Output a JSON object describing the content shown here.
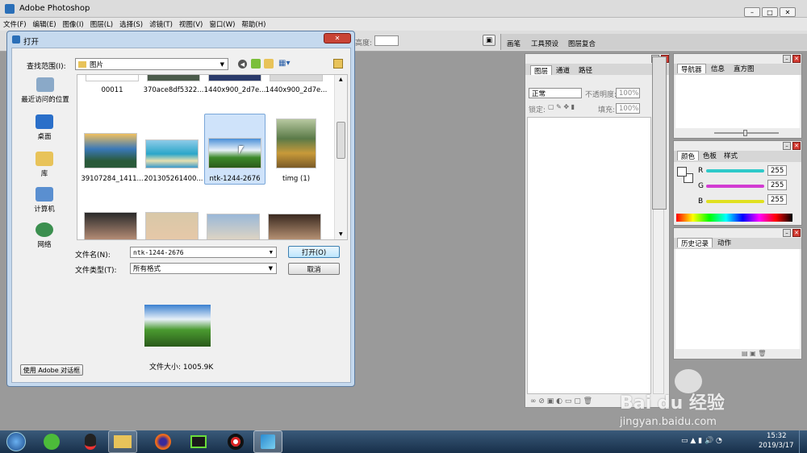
{
  "app": {
    "title": "Adobe Photoshop"
  },
  "menu": [
    "文件(F)",
    "编辑(E)",
    "图像(I)",
    "图层(L)",
    "选择(S)",
    "滤镜(T)",
    "视图(V)",
    "窗口(W)",
    "帮助(H)"
  ],
  "options": {
    "height_label": "高度:"
  },
  "palette_tabs": [
    "画笔",
    "工具预设",
    "图层复合"
  ],
  "dialog": {
    "title": "打开",
    "lookin_label": "查找范围(I):",
    "lookin_value": "图片",
    "places": [
      "最近访问的位置",
      "桌面",
      "库",
      "计算机",
      "网络"
    ],
    "files_row0": [
      "00011",
      "370ace8df5322...",
      "1440x900_2d7e...",
      "1440x900_2d7e..."
    ],
    "files_row1": [
      "39107284_1411...",
      "201305261400...",
      "ntk-1244-2676",
      "timg (1)"
    ],
    "filename_label": "文件名(N):",
    "filename_value": "ntk-1244-2676",
    "filetype_label": "文件类型(T):",
    "filetype_value": "所有格式",
    "open_button": "打开(O)",
    "cancel_button": "取消",
    "filesize": "文件大小: 1005.9K",
    "adobe_dialog_button": "使用 Adobe 对话框"
  },
  "layers": {
    "tabs": [
      "图层",
      "通道",
      "路径"
    ],
    "blend": "正常",
    "opacity_label": "不透明度:",
    "opacity": "100%",
    "lock_label": "锁定:",
    "fill_label": "填充:",
    "fill": "100%"
  },
  "navigator": {
    "tabs": [
      "导航器",
      "信息",
      "直方图"
    ]
  },
  "color": {
    "tabs": [
      "颜色",
      "色板",
      "样式"
    ],
    "channels": [
      {
        "label": "R",
        "value": "255",
        "color": "#2ec9c9"
      },
      {
        "label": "G",
        "value": "255",
        "color": "#d23cd2"
      },
      {
        "label": "B",
        "value": "255",
        "color": "#e0e020"
      }
    ]
  },
  "history": {
    "tabs": [
      "历史记录",
      "动作"
    ]
  },
  "taskbar": {
    "time": "15:32",
    "date": "2019/3/17"
  },
  "watermark": {
    "brand": "Bai du 经验",
    "url": "jingyan.baidu.com"
  }
}
